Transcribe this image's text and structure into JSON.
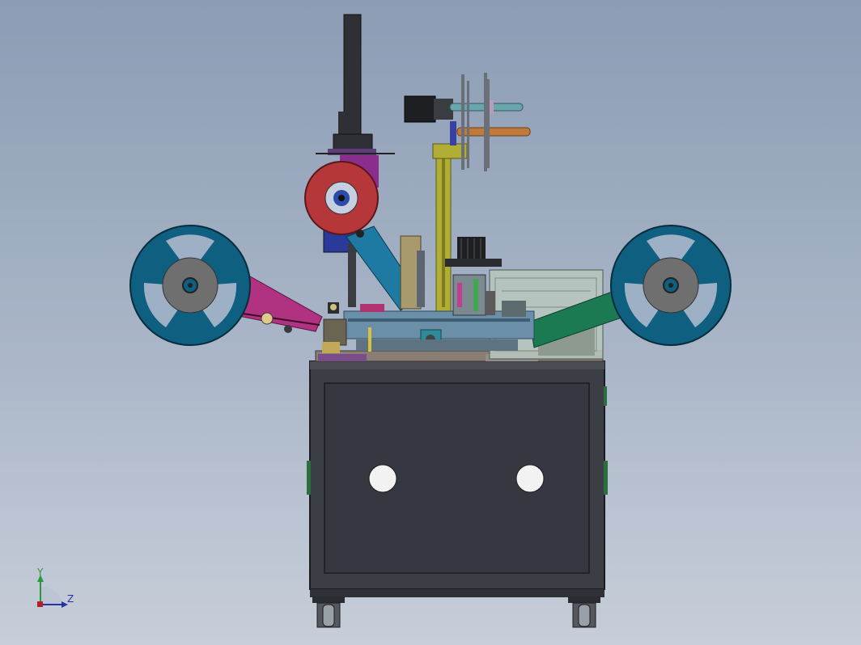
{
  "view": {
    "axes_triad": {
      "y_label": "Y",
      "z_label": "Z"
    }
  },
  "colors": {
    "background_top": "#8b9cb4",
    "background_bottom": "#c7ced9",
    "cabinet": "#3b3e45",
    "reel": "#0f5f80",
    "reel_hub": "#6f6f6f",
    "tape_roll": "#b5373a",
    "left_arm": "#b03280",
    "right_arm": "#1c7a52",
    "post": "#b0ae35",
    "pressure_arm": "#1f7aa3"
  }
}
